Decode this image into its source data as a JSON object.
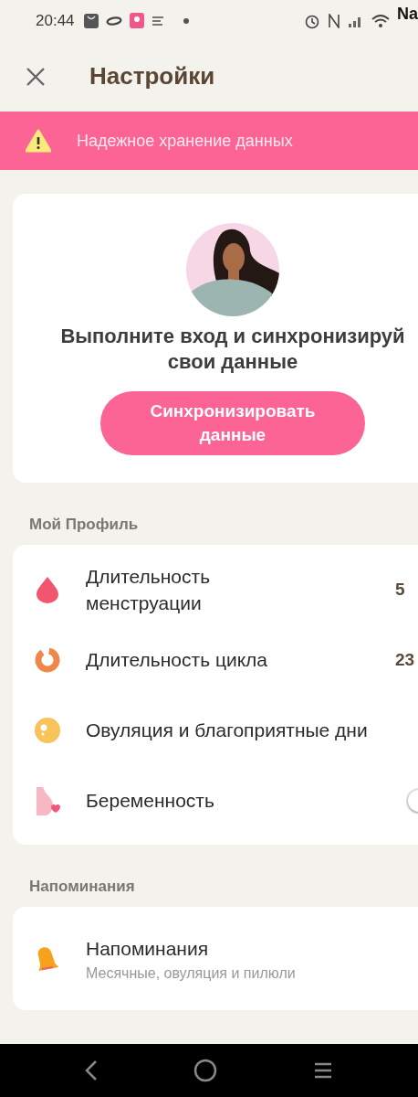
{
  "status_bar": {
    "time": "20:44",
    "carrier": "Na"
  },
  "header": {
    "title": "Настройки"
  },
  "banner": {
    "text": "Надежное хранение данных"
  },
  "sync_card": {
    "title": "Выполните вход и синхронизируй свои данные",
    "button": "Синхронизировать данные"
  },
  "profile": {
    "heading": "Мой Профиль",
    "items": [
      {
        "kind": "value",
        "label": "Длительность менструации",
        "value": "5"
      },
      {
        "kind": "value",
        "label": "Длительность цикла",
        "value": "23"
      },
      {
        "kind": "link",
        "label": "Овуляция и благоприятные дни"
      },
      {
        "kind": "toggle",
        "label": "Беременность",
        "on": false
      }
    ]
  },
  "reminders": {
    "heading": "Напоминания",
    "items": [
      {
        "title": "Напоминания",
        "subtitle": "Месячные, овуляция и пилюли"
      }
    ]
  }
}
